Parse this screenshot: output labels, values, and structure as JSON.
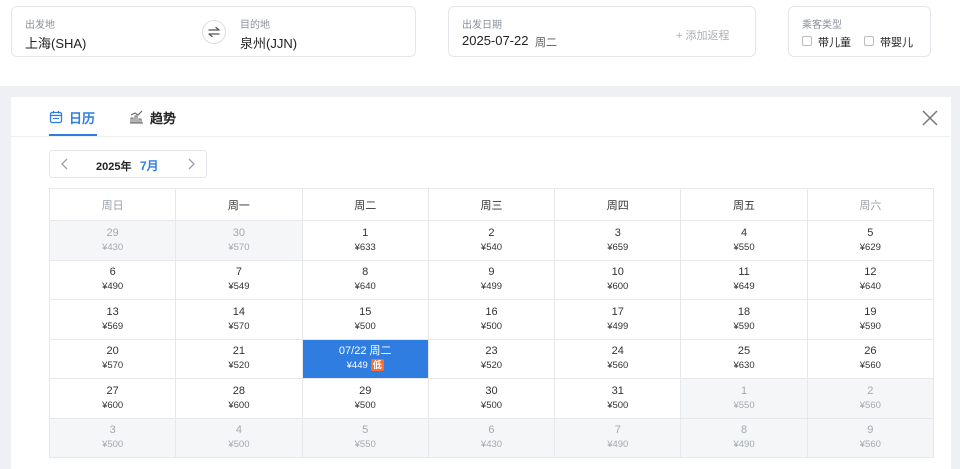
{
  "search": {
    "origin_label": "出发地",
    "origin_value": "上海(SHA)",
    "destination_label": "目的地",
    "destination_value": "泉州(JJN)",
    "date_label": "出发日期",
    "date_value": "2025-07-22",
    "date_weekday": "周二",
    "add_return": "+ 添加返程",
    "passenger_label": "乘客类型",
    "child_label": "带儿童",
    "infant_label": "带婴儿"
  },
  "calendar": {
    "tabs": [
      {
        "label": "日历",
        "icon": "calendar-icon"
      },
      {
        "label": "趋势",
        "icon": "chart-icon"
      }
    ],
    "year": "2025年",
    "month": "7月",
    "weekdays": [
      "周日",
      "周一",
      "周二",
      "周三",
      "周四",
      "周五",
      "周六"
    ],
    "weeks": [
      [
        {
          "day": "29",
          "price": "¥430",
          "state": "off"
        },
        {
          "day": "30",
          "price": "¥570",
          "state": "off"
        },
        {
          "day": "1",
          "price": "¥633"
        },
        {
          "day": "2",
          "price": "¥540"
        },
        {
          "day": "3",
          "price": "¥659"
        },
        {
          "day": "4",
          "price": "¥550"
        },
        {
          "day": "5",
          "price": "¥629"
        }
      ],
      [
        {
          "day": "6",
          "price": "¥490"
        },
        {
          "day": "7",
          "price": "¥549"
        },
        {
          "day": "8",
          "price": "¥640"
        },
        {
          "day": "9",
          "price": "¥499"
        },
        {
          "day": "10",
          "price": "¥600"
        },
        {
          "day": "11",
          "price": "¥649"
        },
        {
          "day": "12",
          "price": "¥640"
        }
      ],
      [
        {
          "day": "13",
          "price": "¥569"
        },
        {
          "day": "14",
          "price": "¥570"
        },
        {
          "day": "15",
          "price": "¥500"
        },
        {
          "day": "16",
          "price": "¥500"
        },
        {
          "day": "17",
          "price": "¥499"
        },
        {
          "day": "18",
          "price": "¥590"
        },
        {
          "day": "19",
          "price": "¥590"
        }
      ],
      [
        {
          "day": "20",
          "price": "¥570"
        },
        {
          "day": "21",
          "price": "¥520"
        },
        {
          "day": "07/22 周二",
          "price": "¥449",
          "state": "selected",
          "tag": "低"
        },
        {
          "day": "23",
          "price": "¥520"
        },
        {
          "day": "24",
          "price": "¥560"
        },
        {
          "day": "25",
          "price": "¥630"
        },
        {
          "day": "26",
          "price": "¥560"
        }
      ],
      [
        {
          "day": "27",
          "price": "¥600"
        },
        {
          "day": "28",
          "price": "¥600"
        },
        {
          "day": "29",
          "price": "¥500"
        },
        {
          "day": "30",
          "price": "¥500"
        },
        {
          "day": "31",
          "price": "¥500"
        },
        {
          "day": "1",
          "price": "¥550",
          "state": "off"
        },
        {
          "day": "2",
          "price": "¥560",
          "state": "off"
        }
      ],
      [
        {
          "day": "3",
          "price": "¥500",
          "state": "off"
        },
        {
          "day": "4",
          "price": "¥500",
          "state": "off"
        },
        {
          "day": "5",
          "price": "¥550",
          "state": "off"
        },
        {
          "day": "6",
          "price": "¥430",
          "state": "off"
        },
        {
          "day": "7",
          "price": "¥490",
          "state": "off"
        },
        {
          "day": "8",
          "price": "¥490",
          "state": "off"
        },
        {
          "day": "9",
          "price": "¥560",
          "state": "off"
        }
      ]
    ]
  },
  "colors": {
    "accent": "#2f7de1",
    "low_tag": "#ff6d2d",
    "background_band": "#eef0f4"
  }
}
